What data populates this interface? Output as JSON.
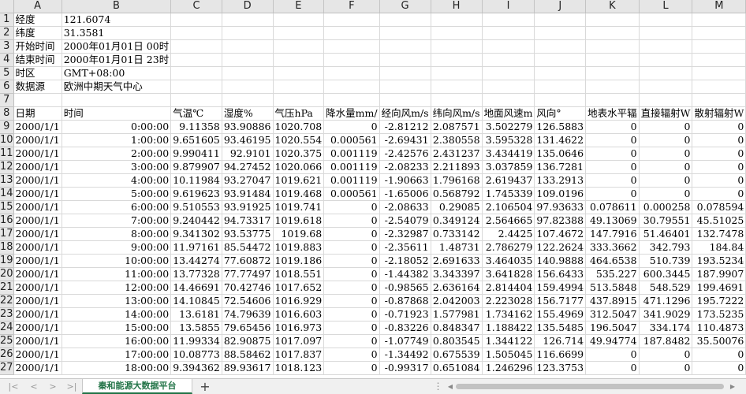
{
  "columns": [
    "A",
    "B",
    "C",
    "D",
    "E",
    "F",
    "G",
    "H",
    "I",
    "J",
    "K",
    "L",
    "M"
  ],
  "rows": [
    {
      "n": "1",
      "cells": [
        "经度",
        "121.6074",
        "",
        "",
        "",
        "",
        "",
        "",
        "",
        "",
        "",
        "",
        ""
      ]
    },
    {
      "n": "2",
      "cells": [
        "纬度",
        "31.3581",
        "",
        "",
        "",
        "",
        "",
        "",
        "",
        "",
        "",
        "",
        ""
      ]
    },
    {
      "n": "3",
      "cells": [
        "开始时间",
        "2000年01月01日 00时",
        "",
        "",
        "",
        "",
        "",
        "",
        "",
        "",
        "",
        "",
        ""
      ]
    },
    {
      "n": "4",
      "cells": [
        "结束时间",
        "2000年01月01日 23时",
        "",
        "",
        "",
        "",
        "",
        "",
        "",
        "",
        "",
        "",
        ""
      ]
    },
    {
      "n": "5",
      "cells": [
        "时区",
        "GMT+08:00",
        "",
        "",
        "",
        "",
        "",
        "",
        "",
        "",
        "",
        "",
        ""
      ]
    },
    {
      "n": "6",
      "cells": [
        "数据源",
        "欧洲中期天气中心",
        "",
        "",
        "",
        "",
        "",
        "",
        "",
        "",
        "",
        "",
        ""
      ]
    },
    {
      "n": "7",
      "cells": [
        "",
        "",
        "",
        "",
        "",
        "",
        "",
        "",
        "",
        "",
        "",
        "",
        ""
      ]
    },
    {
      "n": "8",
      "cells": [
        "日期",
        "时间",
        "气温℃",
        "湿度%",
        "气压hPa",
        "降水量mm/",
        "经向风m/s",
        "纬向风m/s",
        "地面风速m",
        "风向°",
        "地表水平辐",
        "直接辐射W",
        "散射辐射W"
      ]
    },
    {
      "n": "9",
      "cells": [
        "2000/1/1",
        "0:00:00",
        "9.11358",
        "93.90886",
        "1020.708",
        "0",
        "-2.81212",
        "2.087571",
        "3.502279",
        "126.5883",
        "0",
        "0",
        "0"
      ]
    },
    {
      "n": "10",
      "cells": [
        "2000/1/1",
        "1:00:00",
        "9.651605",
        "93.46195",
        "1020.554",
        "0.000561",
        "-2.69431",
        "2.380558",
        "3.595328",
        "131.4622",
        "0",
        "0",
        "0"
      ]
    },
    {
      "n": "11",
      "cells": [
        "2000/1/1",
        "2:00:00",
        "9.990411",
        "92.9101",
        "1020.375",
        "0.001119",
        "-2.42576",
        "2.431237",
        "3.434419",
        "135.0646",
        "0",
        "0",
        "0"
      ]
    },
    {
      "n": "12",
      "cells": [
        "2000/1/1",
        "3:00:00",
        "9.879907",
        "94.27452",
        "1020.066",
        "0.001119",
        "-2.08233",
        "2.211893",
        "3.037859",
        "136.7281",
        "0",
        "0",
        "0"
      ]
    },
    {
      "n": "13",
      "cells": [
        "2000/1/1",
        "4:00:00",
        "10.11984",
        "93.27047",
        "1019.621",
        "0.001119",
        "-1.90663",
        "1.796168",
        "2.619437",
        "133.2913",
        "0",
        "0",
        "0"
      ]
    },
    {
      "n": "14",
      "cells": [
        "2000/1/1",
        "5:00:00",
        "9.619623",
        "93.91484",
        "1019.468",
        "0.000561",
        "-1.65006",
        "0.568792",
        "1.745339",
        "109.0196",
        "0",
        "0",
        "0"
      ]
    },
    {
      "n": "15",
      "cells": [
        "2000/1/1",
        "6:00:00",
        "9.510553",
        "93.91925",
        "1019.741",
        "0",
        "-2.08633",
        "0.29085",
        "2.106504",
        "97.93633",
        "0.078611",
        "0.000258",
        "0.078594"
      ]
    },
    {
      "n": "16",
      "cells": [
        "2000/1/1",
        "7:00:00",
        "9.240442",
        "94.73317",
        "1019.618",
        "0",
        "-2.54079",
        "0.349124",
        "2.564665",
        "97.82388",
        "49.13069",
        "30.79551",
        "45.51025"
      ]
    },
    {
      "n": "17",
      "cells": [
        "2000/1/1",
        "8:00:00",
        "9.341302",
        "93.53775",
        "1019.68",
        "0",
        "-2.32987",
        "0.733142",
        "2.4425",
        "107.4672",
        "147.7916",
        "51.46401",
        "132.7478"
      ]
    },
    {
      "n": "18",
      "cells": [
        "2000/1/1",
        "9:00:00",
        "11.97161",
        "85.54472",
        "1019.883",
        "0",
        "-2.35611",
        "1.48731",
        "2.786279",
        "122.2624",
        "333.3662",
        "342.793",
        "184.84"
      ]
    },
    {
      "n": "19",
      "cells": [
        "2000/1/1",
        "10:00:00",
        "13.44274",
        "77.60872",
        "1019.186",
        "0",
        "-2.18052",
        "2.691633",
        "3.464035",
        "140.9888",
        "464.6538",
        "510.739",
        "193.5234"
      ]
    },
    {
      "n": "20",
      "cells": [
        "2000/1/1",
        "11:00:00",
        "13.77328",
        "77.77497",
        "1018.551",
        "0",
        "-1.44382",
        "3.343397",
        "3.641828",
        "156.6433",
        "535.227",
        "600.3445",
        "187.9907"
      ]
    },
    {
      "n": "21",
      "cells": [
        "2000/1/1",
        "12:00:00",
        "14.46691",
        "70.42746",
        "1017.652",
        "0",
        "-0.98565",
        "2.636164",
        "2.814404",
        "159.4994",
        "513.5848",
        "548.529",
        "199.4691"
      ]
    },
    {
      "n": "22",
      "cells": [
        "2000/1/1",
        "13:00:00",
        "14.10845",
        "72.54606",
        "1016.929",
        "0",
        "-0.87868",
        "2.042003",
        "2.223028",
        "156.7177",
        "437.8915",
        "471.1296",
        "195.7222"
      ]
    },
    {
      "n": "23",
      "cells": [
        "2000/1/1",
        "14:00:00",
        "13.6181",
        "74.79639",
        "1016.603",
        "0",
        "-0.71923",
        "1.577981",
        "1.734162",
        "155.4969",
        "312.5047",
        "341.9029",
        "173.5235"
      ]
    },
    {
      "n": "24",
      "cells": [
        "2000/1/1",
        "15:00:00",
        "13.5855",
        "79.65456",
        "1016.973",
        "0",
        "-0.83226",
        "0.848347",
        "1.188422",
        "135.5485",
        "196.5047",
        "334.174",
        "110.4873"
      ]
    },
    {
      "n": "25",
      "cells": [
        "2000/1/1",
        "16:00:00",
        "11.99334",
        "82.90875",
        "1017.097",
        "0",
        "-1.07749",
        "0.803545",
        "1.344122",
        "126.714",
        "49.94774",
        "187.8482",
        "35.50076"
      ]
    },
    {
      "n": "26",
      "cells": [
        "2000/1/1",
        "17:00:00",
        "10.08773",
        "88.58462",
        "1017.837",
        "0",
        "-1.34492",
        "0.675539",
        "1.505045",
        "116.6699",
        "0",
        "0",
        "0"
      ]
    },
    {
      "n": "27",
      "cells": [
        "2000/1/1",
        "18:00:00",
        "9.394362",
        "89.93617",
        "1018.123",
        "0",
        "-0.99317",
        "0.651084",
        "1.246296",
        "123.3753",
        "0",
        "0",
        "0"
      ]
    }
  ],
  "sheet_tab": "秦和能源大数据平台",
  "icons": {
    "first": "chevron-first-icon",
    "prev": "chevron-left-icon",
    "next": "chevron-right-icon",
    "last": "chevron-last-icon",
    "add": "plus-icon"
  }
}
